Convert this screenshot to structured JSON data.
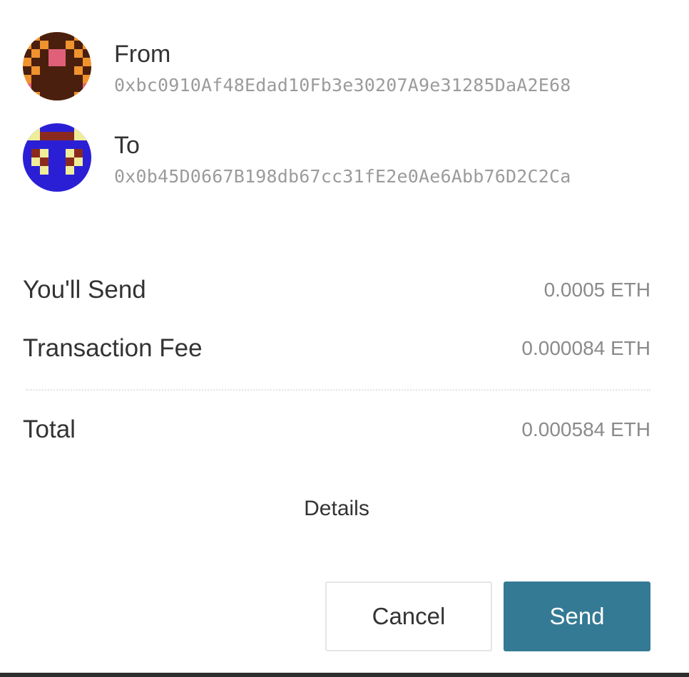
{
  "from": {
    "label": "From",
    "address": "0xbc0910Af48Edad10Fb3e30207A9e31285DaA2E68",
    "avatar_icon": "identicon-orange"
  },
  "to": {
    "label": "To",
    "address": "0x0b45D0667B198db67cc31fE2e0Ae6Abb76D2C2Ca",
    "avatar_icon": "identicon-blue"
  },
  "summary": {
    "send_label": "You'll Send",
    "send_amount": "0.0005 ETH",
    "fee_label": "Transaction Fee",
    "fee_amount": "0.000084 ETH",
    "total_label": "Total",
    "total_amount": "0.000584 ETH"
  },
  "details_label": "Details",
  "actions": {
    "cancel_label": "Cancel",
    "send_label": "Send"
  },
  "colors": {
    "primary": "#357a94",
    "text": "#333333",
    "muted": "#9b9b9b"
  }
}
